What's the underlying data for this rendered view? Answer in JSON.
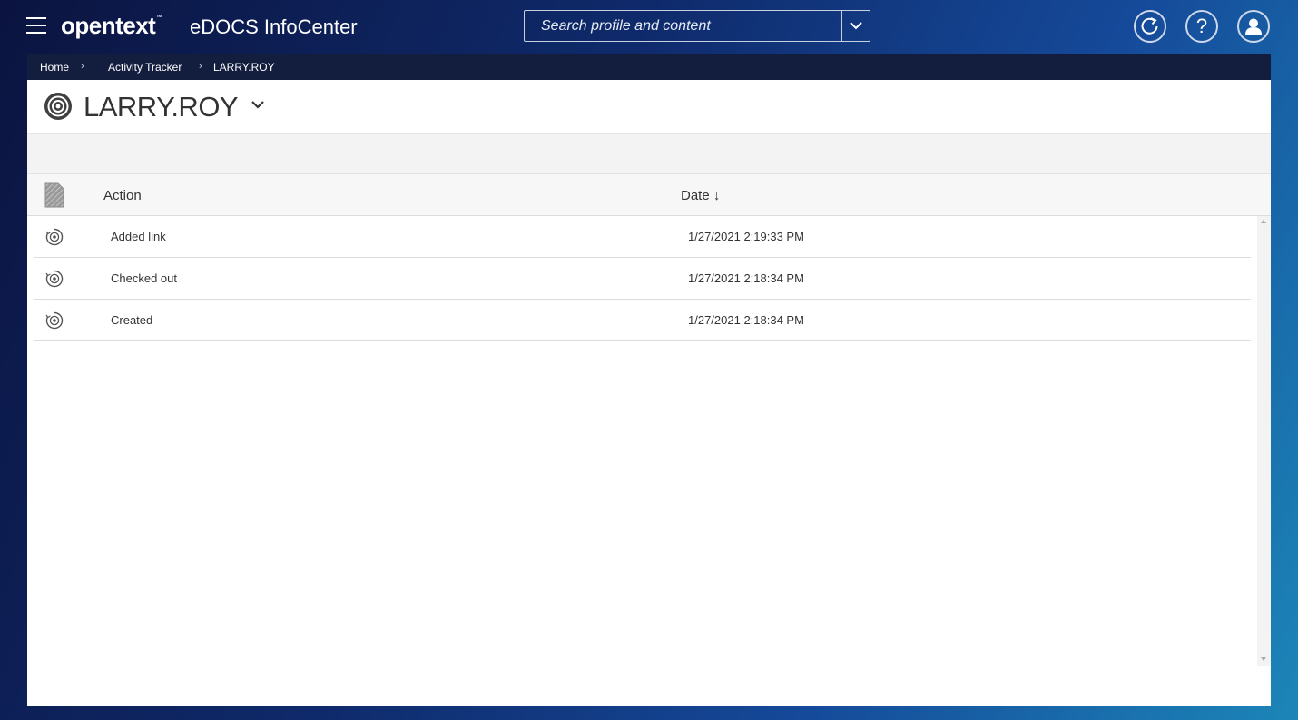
{
  "header": {
    "brand_logo": "opentext",
    "brand_tm": "™",
    "product_name": "eDOCS InfoCenter",
    "search_placeholder": "Search profile and content",
    "icons": [
      "menu-icon",
      "chevron-down-icon",
      "refresh-icon",
      "help-icon",
      "user-icon"
    ],
    "help_glyph": "?"
  },
  "breadcrumb": {
    "items": [
      "Home",
      "Activity Tracker",
      "LARRY.ROY"
    ],
    "separator": "›"
  },
  "page": {
    "title": "LARRY.ROY"
  },
  "list": {
    "columns": {
      "action": "Action",
      "date": "Date",
      "sort_indicator": "↓"
    },
    "rows": [
      {
        "action": "Added link",
        "date": "1/27/2021 2:19:33 PM"
      },
      {
        "action": "Checked out",
        "date": "1/27/2021 2:18:34 PM"
      },
      {
        "action": "Created",
        "date": "1/27/2021 2:18:34 PM"
      }
    ]
  },
  "colors": {
    "breadcrumb_bg": "#131d3e",
    "panel_bg": "#ffffff",
    "header_gradient_start": "#0b1440",
    "header_gradient_end": "#1c86b8"
  }
}
